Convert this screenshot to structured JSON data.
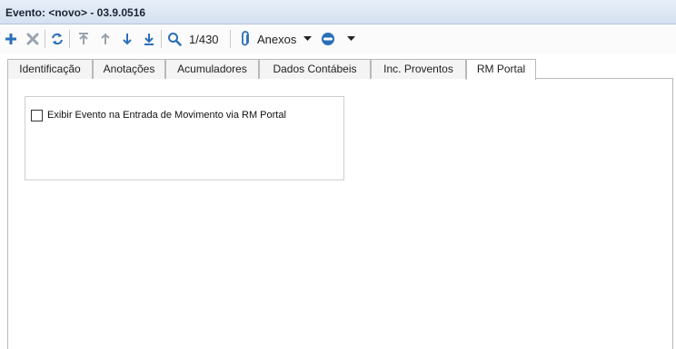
{
  "window": {
    "title": "Evento: <novo> - 03.9.0516"
  },
  "toolbar": {
    "counter": "1/430",
    "anexos_label": "Anexos",
    "icons": [
      "add-icon",
      "delete-icon",
      "refresh-icon",
      "first-record-icon",
      "previous-record-icon",
      "next-record-icon",
      "last-record-icon",
      "search-icon",
      "paperclip-icon",
      "dropdown-arrow-icon",
      "toggle-icon",
      "dropdown-arrow-icon"
    ]
  },
  "tabs": [
    {
      "label": "Identificação"
    },
    {
      "label": "Anotações"
    },
    {
      "label": "Acumuladores"
    },
    {
      "label": "Dados Contábeis"
    },
    {
      "label": "Inc. Proventos"
    },
    {
      "label": "RM Portal",
      "active": true
    }
  ],
  "content": {
    "checkbox_label": "Exibir Evento na Entrada de Movimento via RM Portal",
    "checkbox_checked": false
  },
  "colors": {
    "accent_blue": "#2a6fb8",
    "disabled_gray": "#9aa3ad",
    "titlebar": "#dce6f4"
  }
}
